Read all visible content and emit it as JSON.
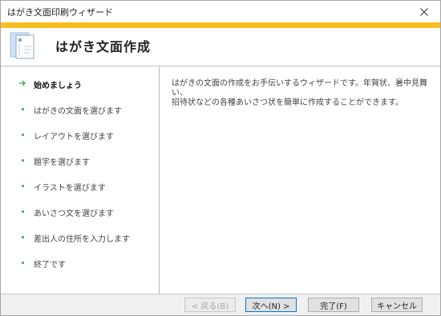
{
  "window": {
    "title": "はがき文面印刷ウィザード"
  },
  "header": {
    "title": "はがき文面作成"
  },
  "steps": [
    {
      "label": "始めましょう",
      "active": true
    },
    {
      "label": "はがきの文面を選びます",
      "active": false
    },
    {
      "label": "レイアウトを選びます",
      "active": false
    },
    {
      "label": "題字を選びます",
      "active": false
    },
    {
      "label": "イラストを選びます",
      "active": false
    },
    {
      "label": "あいさつ文を選びます",
      "active": false
    },
    {
      "label": "差出人の住所を入力します",
      "active": false
    },
    {
      "label": "終了です",
      "active": false
    }
  ],
  "description": {
    "line1": "はがきの文面の作成をお手伝いするウィザードです。年賀状、暑中見舞い、",
    "line2": "招待状などの各種あいさつ状を簡単に作成することができます。"
  },
  "buttons": {
    "back": "< 戻る(B)",
    "next": "次へ(N) >",
    "finish": "完了(F)",
    "cancel": "キャンセル"
  },
  "colors": {
    "accent_stripe": "#f6be21",
    "step_marker": "#35a35a",
    "default_button_border": "#0078d7"
  }
}
